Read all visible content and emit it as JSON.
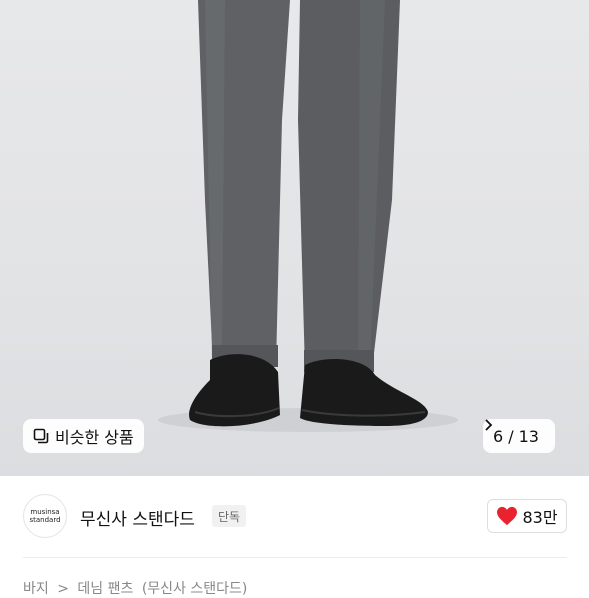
{
  "product_image": {
    "similar_button_label": "비슷한 상품",
    "counter_current": "6",
    "counter_separator": "/",
    "counter_total": "13"
  },
  "brand": {
    "logo_line1": "musinsa",
    "logo_line2": "standard",
    "name": "무신사 스탠다드",
    "tag": "단독"
  },
  "like": {
    "count": "83만",
    "color": "#e8232f"
  },
  "breadcrumb": {
    "items": [
      "바지",
      ">",
      "데님 팬츠",
      "(무신사 스탠다드)"
    ]
  }
}
